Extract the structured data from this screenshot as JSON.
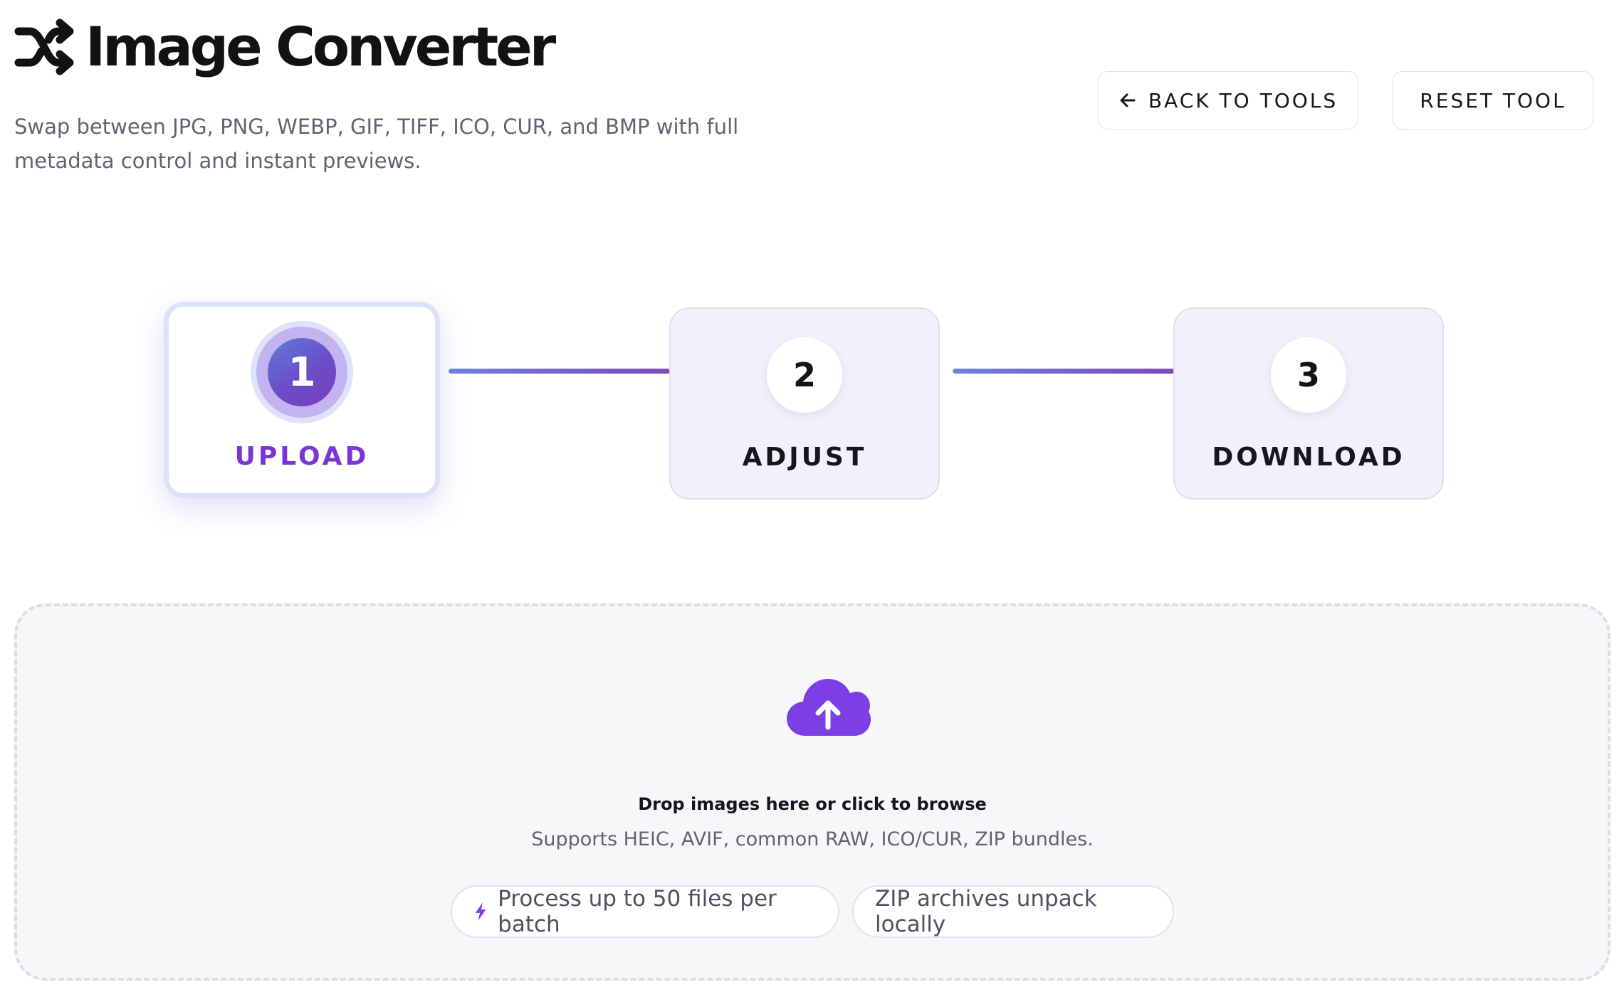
{
  "header": {
    "title": "Image Converter",
    "subtitle": "Swap between JPG, PNG, WEBP, GIF, TIFF, ICO, CUR, and BMP with full metadata control and instant previews.",
    "icon": "shuffle-icon"
  },
  "actions": {
    "back_label": "BACK TO TOOLS",
    "back_icon": "arrow-left-icon",
    "reset_label": "RESET TOOL"
  },
  "stepper": {
    "active_step": 1,
    "steps": [
      {
        "number": "1",
        "label": "UPLOAD"
      },
      {
        "number": "2",
        "label": "ADJUST"
      },
      {
        "number": "3",
        "label": "DOWNLOAD"
      }
    ]
  },
  "dropzone": {
    "icon": "cloud-upload-icon",
    "title": "Drop images here or click to browse",
    "subtitle": "Supports HEIC, AVIF, common RAW, ICO/CUR, ZIP bundles.",
    "chips": [
      {
        "label": "Process up to 50 files per batch",
        "icon": "bolt-icon"
      },
      {
        "label": "ZIP archives unpack locally"
      }
    ]
  },
  "colors": {
    "accent": "#7a35d6",
    "gradient_start": "#6c84dc",
    "gradient_end": "#7a4ab8",
    "step_idle_bg": "#f3f0fb",
    "dropzone_bg": "#f7f7f9"
  }
}
